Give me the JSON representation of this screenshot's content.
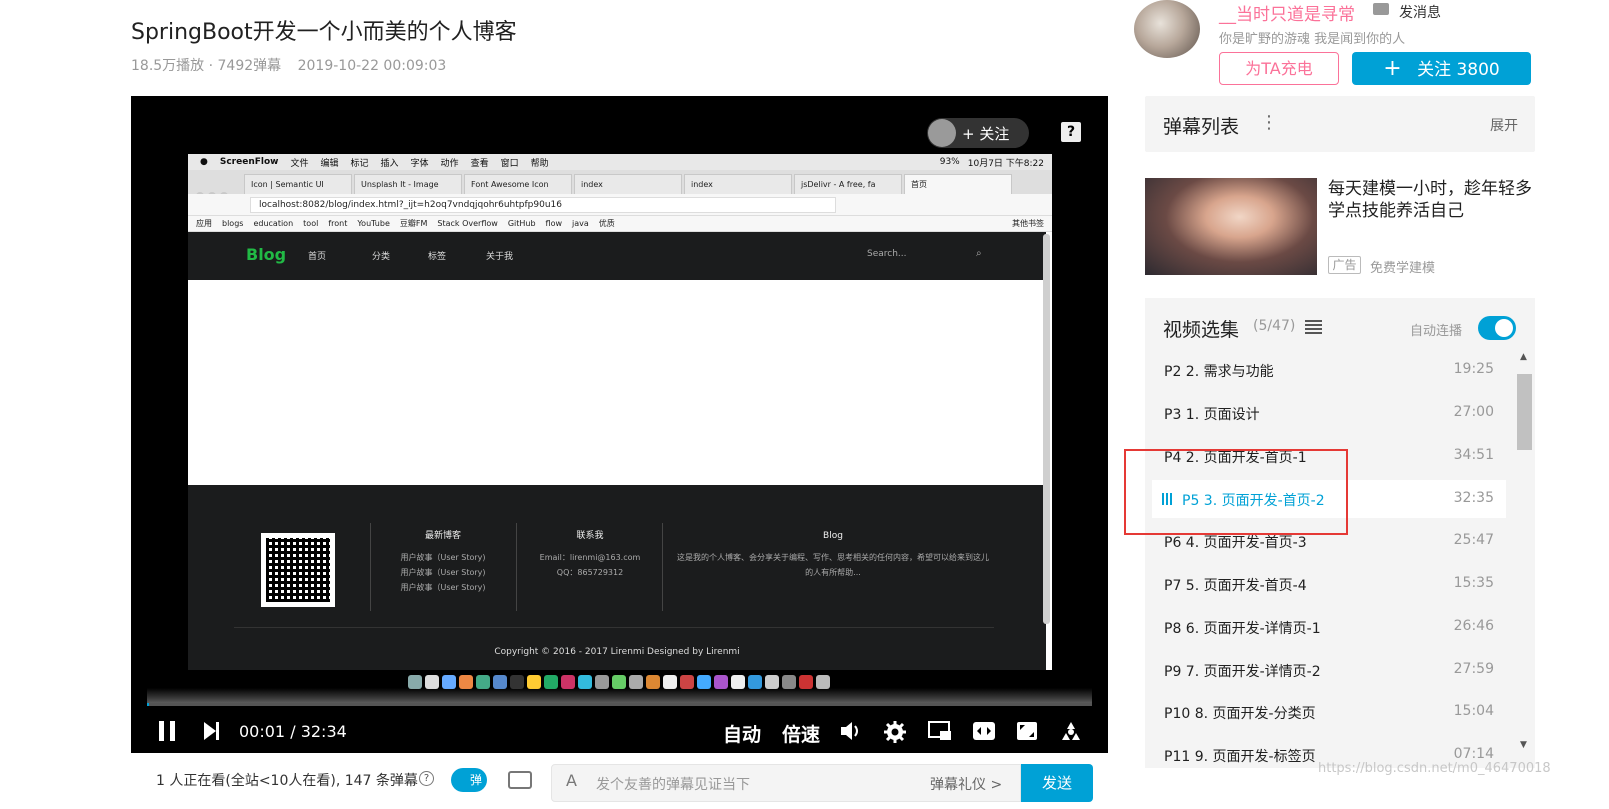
{
  "video": {
    "title": "SpringBoot开发一个小而美的个人博客",
    "plays": "18.5万播放 · 7492弹幕",
    "date": "2019-10-22 00:09:03"
  },
  "player": {
    "overlay_follow": "+ 关注",
    "help": "?",
    "time_current": "00:01",
    "time_separator": "/",
    "time_total": "32:34",
    "auto_label": "自动",
    "speed_label": "倍速",
    "progress_fraction": 0.0005
  },
  "inner_desktop": {
    "menubar": [
      "ScreenFlow",
      "文件",
      "编辑",
      "标记",
      "插入",
      "字体",
      "动作",
      "查看",
      "窗口",
      "帮助"
    ],
    "status": {
      "battery": "93%",
      "clock": "10月7日 下午8:22"
    },
    "tabs": [
      "Icon | Semantic UI",
      "Unsplash It - Image",
      "Font Awesome Icon",
      "index",
      "index",
      "jsDelivr - A free, fa",
      "首页"
    ],
    "address": "localhost:8082/blog/index.html?_ijt=h2oq7vndqjqohr6uhtpfp90u16",
    "bookmarks": [
      "应用",
      "blogs",
      "education",
      "tool",
      "front",
      "YouTube",
      "豆瓣FM",
      "Stack Overflow",
      "GitHub",
      "flow",
      "java",
      "优质",
      "其他书签"
    ],
    "blog": {
      "logo": "Blog",
      "nav": [
        "首页",
        "分类",
        "标签",
        "关于我"
      ],
      "search_placeholder": "Search...",
      "footer": {
        "col1_title": "最新博客",
        "col1_items": [
          "用户故事（User Story)",
          "用户故事（User Story)",
          "用户故事（User Story)"
        ],
        "col2_title": "联系我",
        "col2_items": [
          "Email：lirenmi@163.com",
          "QQ：865729312"
        ],
        "col3_title": "Blog",
        "col3_text": "这是我的个人博客、会分享关于编程、写作、思考相关的任何内容，希望可以给来到这儿的人有所帮助...",
        "copyright": "Copyright © 2016 - 2017 Lirenmi Designed by Lirenmi"
      }
    }
  },
  "uploader": {
    "name": "__当时只道是寻常",
    "message": "发消息",
    "sign": "你是旷野的游魂 我是闻到你的人",
    "charge": "为TA充电",
    "follow": "关注 3800",
    "follow_plus": "+"
  },
  "danmaku_list": {
    "title": "弹幕列表",
    "more": "⋮",
    "expand": "展开"
  },
  "ad": {
    "title": "每天建模一小时，趁年轻多学点技能养活自己",
    "badge": "广告",
    "source": "免费学建模"
  },
  "series": {
    "title": "视频选集",
    "count": "(5/47)",
    "autoplay": "自动连播",
    "episodes": [
      {
        "label": "P2   2. 需求与功能",
        "dur": "19:25"
      },
      {
        "label": "P3   1. 页面设计",
        "dur": "27:00"
      },
      {
        "label": "P4   2. 页面开发-首页-1",
        "dur": "34:51"
      },
      {
        "label": "P5   3. 页面开发-首页-2",
        "dur": "32:35"
      },
      {
        "label": "P6   4. 页面开发-首页-3",
        "dur": "25:47"
      },
      {
        "label": "P7   5. 页面开发-首页-4",
        "dur": "15:35"
      },
      {
        "label": "P8   6. 页面开发-详情页-1",
        "dur": "26:46"
      },
      {
        "label": "P9   7. 页面开发-详情页-2",
        "dur": "27:59"
      },
      {
        "label": "P10   8. 页面开发-分类页",
        "dur": "15:04"
      },
      {
        "label": "P11   9. 页面开发-标签页",
        "dur": "07:14"
      }
    ]
  },
  "bottom": {
    "viewers": "1 人正在看(全站<10人在看), 147 条弹幕",
    "help": "?",
    "danmaku_toggle": "弹",
    "input_icon": "A",
    "input_placeholder": "发个友善的弹幕见证当下",
    "etiquette": "弹幕礼仪 >",
    "send": "发送"
  },
  "watermark": "https://blog.csdn.net/m0_46470018",
  "colors": {
    "accent": "#00a1d6",
    "pink": "#fb7299",
    "highlight_box": "#e53935"
  }
}
